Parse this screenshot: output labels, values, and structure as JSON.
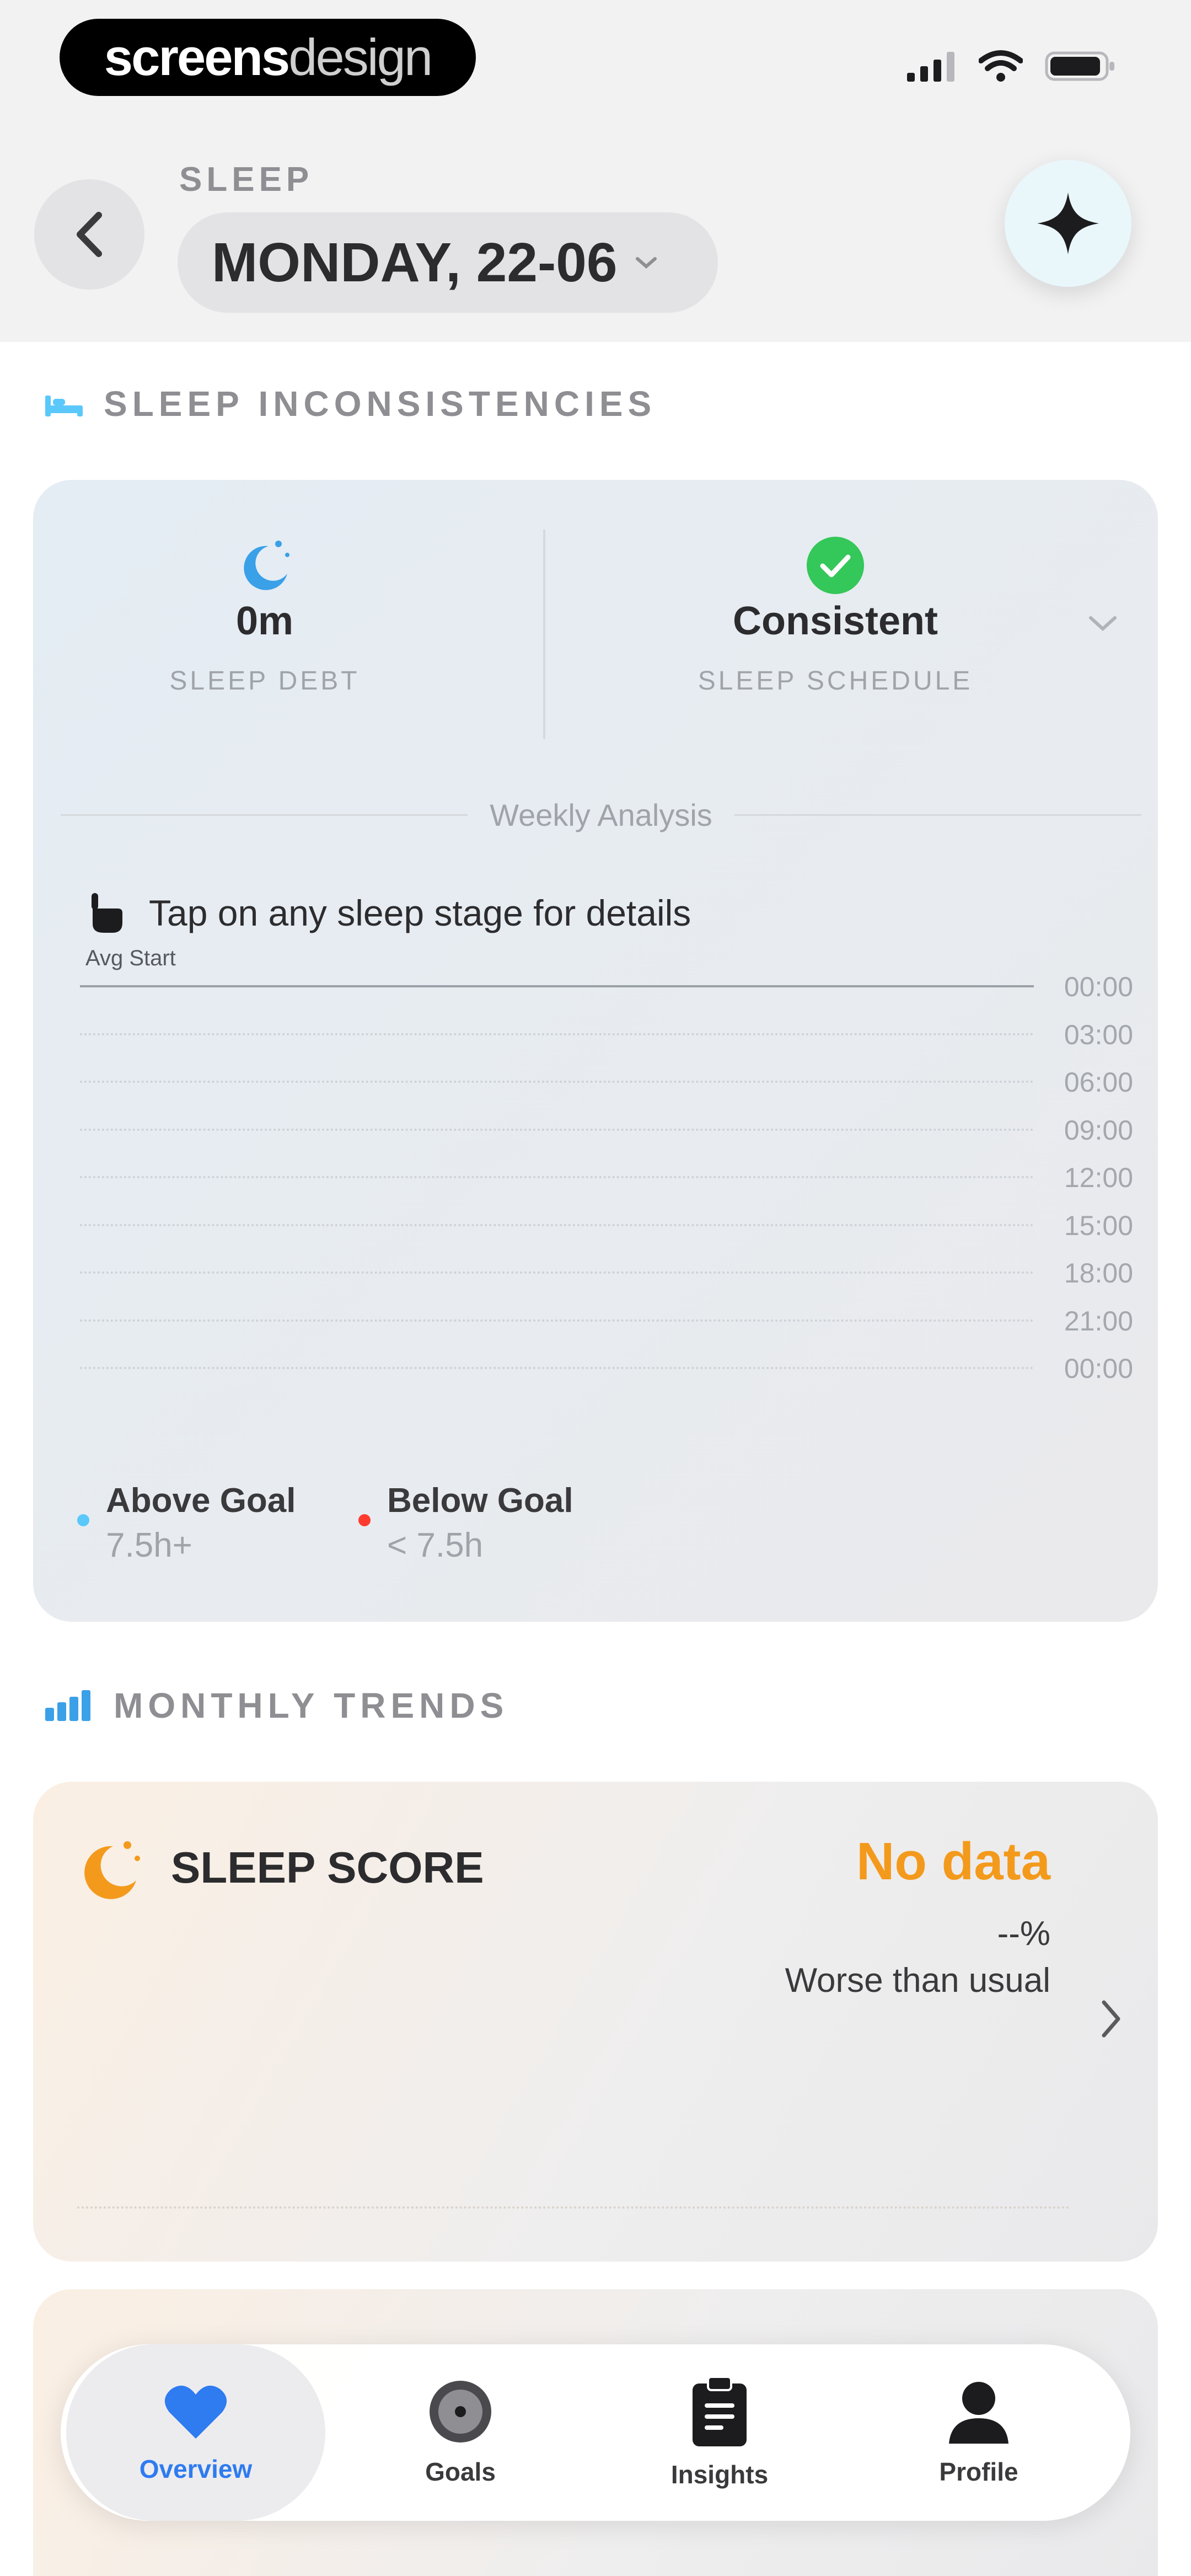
{
  "colors": {
    "accent_blue": "#2f7bf0",
    "orange": "#f39a1c",
    "green": "#34c759",
    "red": "#ff3b30",
    "legend_blue": "#5ac8fa"
  },
  "brand": {
    "part1": "screens",
    "part2": "design"
  },
  "header": {
    "section": "SLEEP",
    "date": "MONDAY, 22-06"
  },
  "inconsistencies": {
    "title": "SLEEP INCONSISTENCIES",
    "sleep_debt": {
      "value": "0m",
      "label": "SLEEP DEBT",
      "icon": "moon-stars-icon"
    },
    "schedule": {
      "value": "Consistent",
      "label": "SLEEP SCHEDULE",
      "icon": "check-circle-icon"
    },
    "weekly_label": "Weekly Analysis",
    "hint": "Tap on any sleep stage for details",
    "avg_label": "Avg Start",
    "ticks": [
      "00:00",
      "03:00",
      "06:00",
      "09:00",
      "12:00",
      "15:00",
      "18:00",
      "21:00",
      "00:00"
    ],
    "legend": [
      {
        "name": "Above Goal",
        "sub": "7.5h+",
        "color": "#5ac8fa"
      },
      {
        "name": "Below Goal",
        "sub": "< 7.5h",
        "color": "#ff3b30"
      }
    ]
  },
  "trends": {
    "title": "MONTHLY TRENDS",
    "sleep_score": {
      "title": "SLEEP SCORE",
      "status": "No data",
      "pct": "--%",
      "comparison": "Worse than usual"
    }
  },
  "tabs": [
    {
      "label": "Overview",
      "icon": "heart-icon",
      "active": true
    },
    {
      "label": "Goals",
      "icon": "target-icon",
      "active": false
    },
    {
      "label": "Insights",
      "icon": "clipboard-icon",
      "active": false
    },
    {
      "label": "Profile",
      "icon": "person-icon",
      "active": false
    }
  ]
}
